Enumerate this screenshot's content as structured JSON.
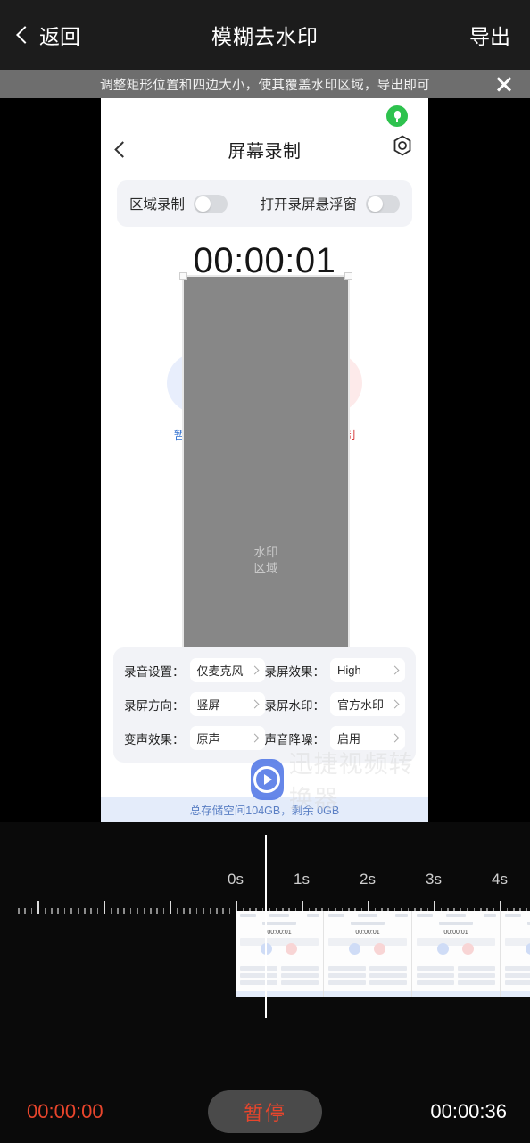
{
  "topnav": {
    "back_label": "返回",
    "title": "模糊去水印",
    "export_label": "导出"
  },
  "hint": {
    "text": "调整矩形位置和四边大小，使其覆盖水印区域，导出即可",
    "close_label": "×"
  },
  "preview": {
    "phone": {
      "header_title": "屏幕录制",
      "toggles": [
        {
          "label": "区域录制",
          "on": false
        },
        {
          "label": "打开录屏悬浮窗",
          "on": false
        }
      ],
      "timer": "00:00:01",
      "controls": [
        {
          "label": "暂停录制",
          "icon": "pause-icon"
        },
        {
          "label": "停止录制",
          "icon": "stop-icon"
        }
      ],
      "settings": [
        [
          {
            "key": "录音设置：",
            "value": "仅麦克风"
          },
          {
            "key": "录屏效果：",
            "value": "High"
          }
        ],
        [
          {
            "key": "录屏方向：",
            "value": "竖屏"
          },
          {
            "key": "录屏水印：",
            "value": "官方水印"
          }
        ],
        [
          {
            "key": "变声效果：",
            "value": "原声"
          },
          {
            "key": "声音降噪：",
            "value": "启用"
          }
        ]
      ],
      "storage_text": "总存储空间104GB，剩余 0GB",
      "brand_text": "迅捷视频转换器"
    },
    "mask_caption_line1": "水印",
    "mask_caption_line2": "区域"
  },
  "timeline": {
    "ticks": [
      "0s",
      "1s",
      "2s",
      "3s",
      "4s"
    ],
    "tick_seconds": [
      0,
      1,
      2,
      3,
      4
    ],
    "playhead_time": "00:00:00"
  },
  "bottombar": {
    "current_time": "00:00:00",
    "play_label": "暂停",
    "total_time": "00:00:36"
  },
  "colors": {
    "accent_red": "#e8452c",
    "nav_bg": "#1c1c1c",
    "hint_bg": "#6e6e6e",
    "mic_green": "#2ec24e",
    "pause_blue": "#2f6fd0",
    "stop_red": "#d63a3a",
    "brand_blue": "#4c73e6"
  }
}
